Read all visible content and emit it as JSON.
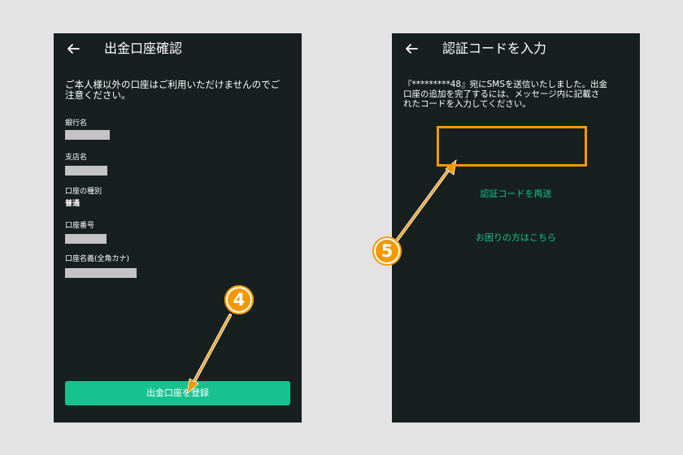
{
  "left_screen": {
    "title": "出金口座確認",
    "description": "ご本人様以外の口座はご利用いただけませんのでご\n注意ください。",
    "fields": [
      {
        "label": "銀行名",
        "value": ""
      },
      {
        "label": "支店名",
        "value": ""
      },
      {
        "label": "口座の種別",
        "value": "普通"
      },
      {
        "label": "口座番号",
        "value": ""
      },
      {
        "label": "口座名義(全角カナ)",
        "value": ""
      }
    ],
    "register_button": "出金口座を登録"
  },
  "right_screen": {
    "title": "認証コードを入力",
    "description": "『*********48』宛にSMSを送信いたしました。出金\n口座の追加を完了するには、メッセージ内に記載さ\nれたコードを入力してください。",
    "code_value": "",
    "resend_link": "認証コードを再送",
    "help_link": "お困りの方はこちら"
  },
  "annotations": {
    "step4": "4",
    "step5": "5"
  },
  "colors": {
    "screen_bg": "#17201e",
    "accent_green": "#17c28f",
    "annotation_orange": "#f39800",
    "page_bg": "#e3e3e3"
  }
}
